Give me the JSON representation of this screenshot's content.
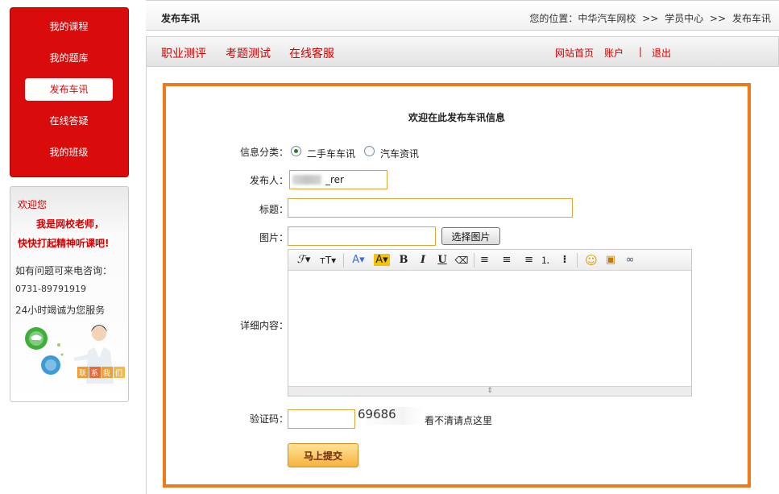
{
  "sidebar": {
    "items": [
      {
        "label": "我的课程"
      },
      {
        "label": "我的题库"
      },
      {
        "label": "发布车讯"
      },
      {
        "label": "在线答疑"
      },
      {
        "label": "我的班级"
      }
    ],
    "active_index": 2
  },
  "welcome": {
    "greeting": "欢迎您",
    "role_line": "我是网校老师，",
    "encourage_line": "快快打起精神听课吧!",
    "contact_prompt": "如有问题可来电咨询：",
    "phone": "0731-89791919",
    "service_hours": "24小时竭诚为您服务",
    "contact_badge": "联系我们"
  },
  "topbar": {
    "title": "发布车讯",
    "location_prefix": "您的位置：",
    "crumbs": [
      "中华汽车网校",
      ">>",
      "学员中心",
      ">>",
      "发布车讯"
    ]
  },
  "menubar": {
    "links": [
      "职业测评",
      "考题测试",
      "在线客服"
    ],
    "right_links": {
      "home": "网站首页",
      "account": "账户",
      "divider": "|",
      "logout": "退出"
    }
  },
  "form": {
    "heading": "欢迎在此发布车讯信息",
    "category_label": "信息分类：",
    "category_options": [
      {
        "label": "二手车车讯",
        "checked": true
      },
      {
        "label": "汽车资讯",
        "checked": false
      }
    ],
    "author_label": "发布人：",
    "author_value": "_rer",
    "title_label": "标题：",
    "title_value": "",
    "image_label": "图片：",
    "image_value": "",
    "image_button": "选择图片",
    "content_label": "详细内容：",
    "editor_toolbar": [
      {
        "name": "font-family",
        "glyph": "ℱ▾"
      },
      {
        "name": "font-size",
        "glyph": "ᴛT▾"
      },
      {
        "name": "font-color",
        "glyph": "A▾"
      },
      {
        "name": "background-color",
        "glyph": "A▾"
      },
      {
        "name": "bold",
        "glyph": "B"
      },
      {
        "name": "italic",
        "glyph": "I"
      },
      {
        "name": "underline",
        "glyph": "U"
      },
      {
        "name": "remove-format",
        "glyph": "⌫"
      },
      {
        "name": "align-left",
        "glyph": "≡"
      },
      {
        "name": "align-center",
        "glyph": "≡"
      },
      {
        "name": "align-right",
        "glyph": "≡"
      },
      {
        "name": "ordered-list",
        "glyph": "⒈"
      },
      {
        "name": "unordered-list",
        "glyph": "⁝"
      },
      {
        "name": "emoticon",
        "glyph": "☺"
      },
      {
        "name": "insert-image",
        "glyph": "▣"
      },
      {
        "name": "link",
        "glyph": "∞"
      }
    ],
    "captcha_label": "验证码：",
    "captcha_value": "",
    "captcha_code": "69686",
    "captcha_refresh": "看不清请点这里",
    "submit": "马上提交"
  },
  "colors": {
    "brand_red": "#d90b0b",
    "form_border": "#f07a1a",
    "input_border": "#e0a43c",
    "submit_gradient": [
      "#ffe39a",
      "#f7b33c"
    ]
  }
}
